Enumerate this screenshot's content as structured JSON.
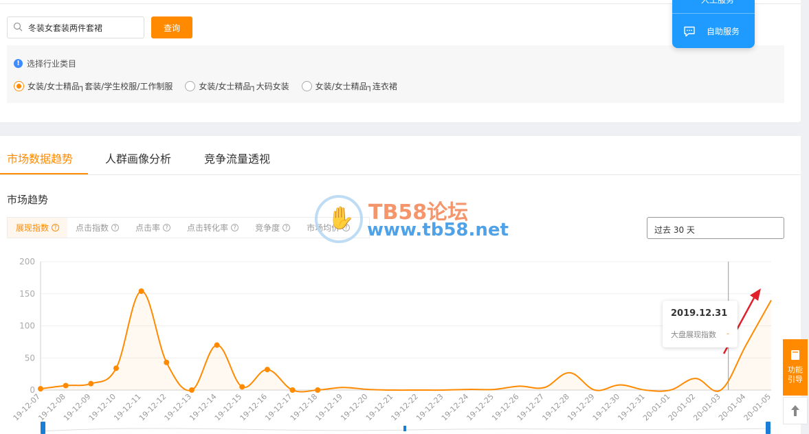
{
  "search": {
    "value": "冬装女套装两件套裙",
    "button_label": "查询"
  },
  "industry": {
    "title": "选择行业类目",
    "options": [
      {
        "label": "女装/女士精品┐套装/学生校服/工作制服",
        "selected": true
      },
      {
        "label": "女装/女士精品┐大码女装",
        "selected": false
      },
      {
        "label": "女装/女士精品┐连衣裙",
        "selected": false
      }
    ]
  },
  "service": {
    "partial_label": "人工服务",
    "self_service_label": "自助服务"
  },
  "tabs": [
    "市场数据趋势",
    "人群画像分析",
    "竞争流量透视"
  ],
  "active_tab": 0,
  "section_title": "市场趋势",
  "metrics": [
    "展现指数",
    "点击指数",
    "点击率",
    "点击转化率",
    "竞争度",
    "市场均价"
  ],
  "active_metric": 0,
  "range_label": "过去 30 天",
  "watermark": {
    "title": "TB58论坛",
    "url": "www.tb58.net"
  },
  "tooltip": {
    "date": "2019.12.31",
    "label": "大盘展现指数",
    "value": "-"
  },
  "side_help": {
    "label_line1": "功能",
    "label_line2": "引导"
  },
  "colors": {
    "accent": "#ff8a00",
    "service_blue": "#1f9bff",
    "arrow_red": "#e0202a"
  },
  "chart_data": {
    "type": "line",
    "x": [
      "19-12-07",
      "19-12-08",
      "19-12-09",
      "19-12-10",
      "19-12-11",
      "19-12-12",
      "19-12-13",
      "19-12-14",
      "19-12-15",
      "19-12-16",
      "19-12-17",
      "19-12-18",
      "19-12-19",
      "19-12-20",
      "19-12-21",
      "19-12-22",
      "19-12-23",
      "19-12-24",
      "19-12-25",
      "19-12-26",
      "19-12-27",
      "19-12-28",
      "19-12-29",
      "19-12-30",
      "19-12-31",
      "20-01-01",
      "20-01-02",
      "20-01-03",
      "20-01-04",
      "20-01-05"
    ],
    "series": [
      {
        "values": [
          2,
          7,
          10,
          34,
          154,
          43,
          0,
          70,
          5,
          32,
          0,
          0,
          4,
          1,
          0,
          0,
          0,
          1,
          1,
          6,
          4,
          27,
          0,
          8,
          0,
          0,
          18,
          0,
          70,
          140
        ]
      }
    ],
    "ylim": [
      0,
      200
    ],
    "yticks": [
      0,
      50,
      100,
      150,
      200
    ],
    "markers_through_index": 11,
    "grid": true
  }
}
